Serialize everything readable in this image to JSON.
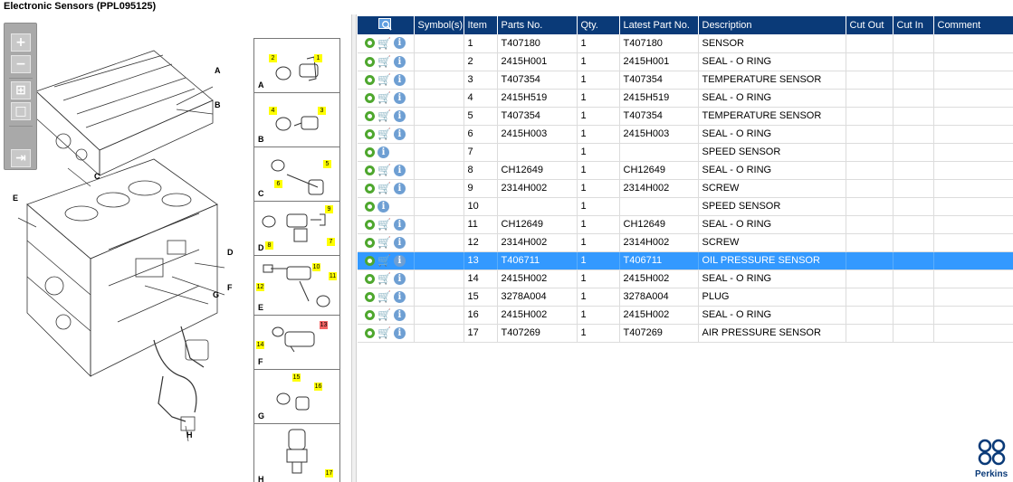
{
  "title": "Electronic Sensors (PPL095125)",
  "toolbar": {
    "buttons": [
      {
        "name": "zoom-in-button",
        "glyph": "+"
      },
      {
        "name": "zoom-out-button",
        "glyph": "−"
      },
      {
        "name": "fit-all-button",
        "glyph": "⊞"
      },
      {
        "name": "fit-window-button",
        "glyph": "□"
      },
      {
        "name": "collapse-panel-button",
        "glyph": "⇥"
      }
    ]
  },
  "illustration": {
    "labels": [
      "A",
      "B",
      "C",
      "D",
      "E",
      "F",
      "G",
      "H"
    ],
    "detail_cells": [
      {
        "letter": "A",
        "callouts": [
          "2",
          "1"
        ]
      },
      {
        "letter": "B",
        "callouts": [
          "4",
          "3"
        ]
      },
      {
        "letter": "C",
        "callouts": [
          "5",
          "6"
        ]
      },
      {
        "letter": "D",
        "callouts": [
          "9",
          "8",
          "7"
        ]
      },
      {
        "letter": "E",
        "callouts": [
          "10",
          "11",
          "12"
        ]
      },
      {
        "letter": "F",
        "callouts": [
          "13",
          "14"
        ]
      },
      {
        "letter": "G",
        "callouts": [
          "15",
          "16"
        ]
      },
      {
        "letter": "H",
        "callouts": [
          "17"
        ]
      }
    ]
  },
  "table": {
    "columns": [
      "Symbol(s)",
      "Item",
      "Parts No.",
      "Qty.",
      "Latest Part No.",
      "Description",
      "Cut Out",
      "Cut In",
      "Comment"
    ],
    "rows": [
      {
        "cart": true,
        "item": "1",
        "part": "T407180",
        "qty": "1",
        "latest": "T407180",
        "desc": "SENSOR"
      },
      {
        "cart": true,
        "item": "2",
        "part": "2415H001",
        "qty": "1",
        "latest": "2415H001",
        "desc": "SEAL - O RING"
      },
      {
        "cart": true,
        "item": "3",
        "part": "T407354",
        "qty": "1",
        "latest": "T407354",
        "desc": "TEMPERATURE SENSOR"
      },
      {
        "cart": true,
        "item": "4",
        "part": "2415H519",
        "qty": "1",
        "latest": "2415H519",
        "desc": "SEAL - O RING"
      },
      {
        "cart": true,
        "item": "5",
        "part": "T407354",
        "qty": "1",
        "latest": "T407354",
        "desc": "TEMPERATURE SENSOR"
      },
      {
        "cart": true,
        "item": "6",
        "part": "2415H003",
        "qty": "1",
        "latest": "2415H003",
        "desc": "SEAL - O RING"
      },
      {
        "cart": false,
        "item": "7",
        "part": "",
        "qty": "1",
        "latest": "",
        "desc": "SPEED SENSOR"
      },
      {
        "cart": true,
        "item": "8",
        "part": "CH12649",
        "qty": "1",
        "latest": "CH12649",
        "desc": "SEAL - O RING"
      },
      {
        "cart": true,
        "item": "9",
        "part": "2314H002",
        "qty": "1",
        "latest": "2314H002",
        "desc": "SCREW"
      },
      {
        "cart": false,
        "item": "10",
        "part": "",
        "qty": "1",
        "latest": "",
        "desc": "SPEED SENSOR"
      },
      {
        "cart": true,
        "item": "11",
        "part": "CH12649",
        "qty": "1",
        "latest": "CH12649",
        "desc": "SEAL - O RING"
      },
      {
        "cart": true,
        "item": "12",
        "part": "2314H002",
        "qty": "1",
        "latest": "2314H002",
        "desc": "SCREW"
      },
      {
        "cart": true,
        "item": "13",
        "part": "T406711",
        "qty": "1",
        "latest": "T406711",
        "desc": "OIL PRESSURE SENSOR",
        "selected": true
      },
      {
        "cart": true,
        "item": "14",
        "part": "2415H002",
        "qty": "1",
        "latest": "2415H002",
        "desc": "SEAL - O RING"
      },
      {
        "cart": true,
        "item": "15",
        "part": "3278A004",
        "qty": "1",
        "latest": "3278A004",
        "desc": "PLUG"
      },
      {
        "cart": true,
        "item": "16",
        "part": "2415H002",
        "qty": "1",
        "latest": "2415H002",
        "desc": "SEAL - O RING"
      },
      {
        "cart": true,
        "item": "17",
        "part": "T407269",
        "qty": "1",
        "latest": "T407269",
        "desc": "AIR PRESSURE SENSOR"
      }
    ]
  },
  "logo": {
    "text": "Perkins"
  },
  "colors": {
    "header": "#0a3a78",
    "selected": "#3399ff",
    "callout": "#ffff00"
  }
}
